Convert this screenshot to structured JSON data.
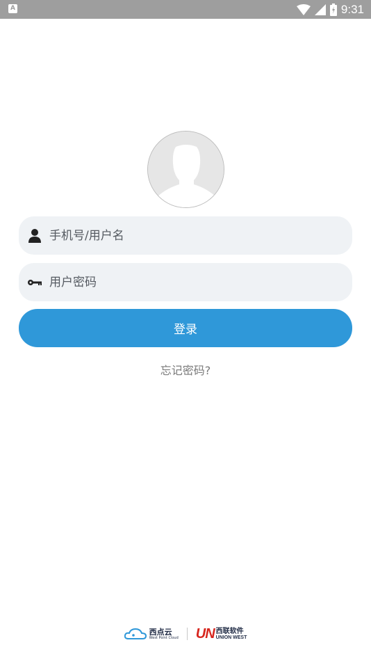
{
  "status_bar": {
    "app_icon_letter": "A",
    "time": "9:31",
    "icons": [
      "wifi-icon",
      "signal-icon",
      "battery-icon"
    ]
  },
  "login": {
    "avatar": "default-user-avatar",
    "username_placeholder": "手机号/用户名",
    "password_placeholder": "用户密码",
    "login_label": "登录",
    "forgot_label": "忘记密码?"
  },
  "footer": {
    "cloud_logo_cn": "西点云",
    "cloud_logo_en": "West Point Cloud",
    "union_logo_mark": "UN",
    "union_logo_cn": "西联软件",
    "union_logo_en": "UNION WEST"
  },
  "colors": {
    "status_bar": "#9e9e9e",
    "field_bg": "#eff2f5",
    "primary": "#2f98d9",
    "union_red": "#d7261e"
  }
}
